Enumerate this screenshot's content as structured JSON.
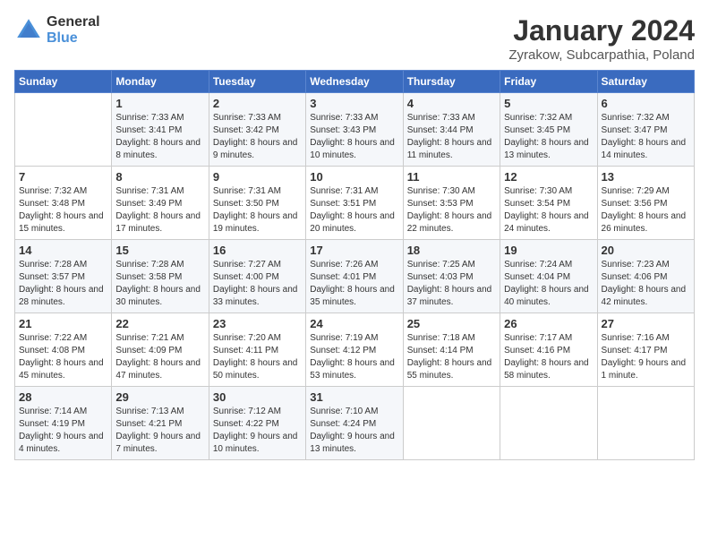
{
  "header": {
    "logo_line1": "General",
    "logo_line2": "Blue",
    "title": "January 2024",
    "subtitle": "Zyrakow, Subcarpathia, Poland"
  },
  "weekdays": [
    "Sunday",
    "Monday",
    "Tuesday",
    "Wednesday",
    "Thursday",
    "Friday",
    "Saturday"
  ],
  "weeks": [
    [
      {
        "day": "",
        "sunrise": "",
        "sunset": "",
        "daylight": ""
      },
      {
        "day": "1",
        "sunrise": "Sunrise: 7:33 AM",
        "sunset": "Sunset: 3:41 PM",
        "daylight": "Daylight: 8 hours and 8 minutes."
      },
      {
        "day": "2",
        "sunrise": "Sunrise: 7:33 AM",
        "sunset": "Sunset: 3:42 PM",
        "daylight": "Daylight: 8 hours and 9 minutes."
      },
      {
        "day": "3",
        "sunrise": "Sunrise: 7:33 AM",
        "sunset": "Sunset: 3:43 PM",
        "daylight": "Daylight: 8 hours and 10 minutes."
      },
      {
        "day": "4",
        "sunrise": "Sunrise: 7:33 AM",
        "sunset": "Sunset: 3:44 PM",
        "daylight": "Daylight: 8 hours and 11 minutes."
      },
      {
        "day": "5",
        "sunrise": "Sunrise: 7:32 AM",
        "sunset": "Sunset: 3:45 PM",
        "daylight": "Daylight: 8 hours and 13 minutes."
      },
      {
        "day": "6",
        "sunrise": "Sunrise: 7:32 AM",
        "sunset": "Sunset: 3:47 PM",
        "daylight": "Daylight: 8 hours and 14 minutes."
      }
    ],
    [
      {
        "day": "7",
        "sunrise": "Sunrise: 7:32 AM",
        "sunset": "Sunset: 3:48 PM",
        "daylight": "Daylight: 8 hours and 15 minutes."
      },
      {
        "day": "8",
        "sunrise": "Sunrise: 7:31 AM",
        "sunset": "Sunset: 3:49 PM",
        "daylight": "Daylight: 8 hours and 17 minutes."
      },
      {
        "day": "9",
        "sunrise": "Sunrise: 7:31 AM",
        "sunset": "Sunset: 3:50 PM",
        "daylight": "Daylight: 8 hours and 19 minutes."
      },
      {
        "day": "10",
        "sunrise": "Sunrise: 7:31 AM",
        "sunset": "Sunset: 3:51 PM",
        "daylight": "Daylight: 8 hours and 20 minutes."
      },
      {
        "day": "11",
        "sunrise": "Sunrise: 7:30 AM",
        "sunset": "Sunset: 3:53 PM",
        "daylight": "Daylight: 8 hours and 22 minutes."
      },
      {
        "day": "12",
        "sunrise": "Sunrise: 7:30 AM",
        "sunset": "Sunset: 3:54 PM",
        "daylight": "Daylight: 8 hours and 24 minutes."
      },
      {
        "day": "13",
        "sunrise": "Sunrise: 7:29 AM",
        "sunset": "Sunset: 3:56 PM",
        "daylight": "Daylight: 8 hours and 26 minutes."
      }
    ],
    [
      {
        "day": "14",
        "sunrise": "Sunrise: 7:28 AM",
        "sunset": "Sunset: 3:57 PM",
        "daylight": "Daylight: 8 hours and 28 minutes."
      },
      {
        "day": "15",
        "sunrise": "Sunrise: 7:28 AM",
        "sunset": "Sunset: 3:58 PM",
        "daylight": "Daylight: 8 hours and 30 minutes."
      },
      {
        "day": "16",
        "sunrise": "Sunrise: 7:27 AM",
        "sunset": "Sunset: 4:00 PM",
        "daylight": "Daylight: 8 hours and 33 minutes."
      },
      {
        "day": "17",
        "sunrise": "Sunrise: 7:26 AM",
        "sunset": "Sunset: 4:01 PM",
        "daylight": "Daylight: 8 hours and 35 minutes."
      },
      {
        "day": "18",
        "sunrise": "Sunrise: 7:25 AM",
        "sunset": "Sunset: 4:03 PM",
        "daylight": "Daylight: 8 hours and 37 minutes."
      },
      {
        "day": "19",
        "sunrise": "Sunrise: 7:24 AM",
        "sunset": "Sunset: 4:04 PM",
        "daylight": "Daylight: 8 hours and 40 minutes."
      },
      {
        "day": "20",
        "sunrise": "Sunrise: 7:23 AM",
        "sunset": "Sunset: 4:06 PM",
        "daylight": "Daylight: 8 hours and 42 minutes."
      }
    ],
    [
      {
        "day": "21",
        "sunrise": "Sunrise: 7:22 AM",
        "sunset": "Sunset: 4:08 PM",
        "daylight": "Daylight: 8 hours and 45 minutes."
      },
      {
        "day": "22",
        "sunrise": "Sunrise: 7:21 AM",
        "sunset": "Sunset: 4:09 PM",
        "daylight": "Daylight: 8 hours and 47 minutes."
      },
      {
        "day": "23",
        "sunrise": "Sunrise: 7:20 AM",
        "sunset": "Sunset: 4:11 PM",
        "daylight": "Daylight: 8 hours and 50 minutes."
      },
      {
        "day": "24",
        "sunrise": "Sunrise: 7:19 AM",
        "sunset": "Sunset: 4:12 PM",
        "daylight": "Daylight: 8 hours and 53 minutes."
      },
      {
        "day": "25",
        "sunrise": "Sunrise: 7:18 AM",
        "sunset": "Sunset: 4:14 PM",
        "daylight": "Daylight: 8 hours and 55 minutes."
      },
      {
        "day": "26",
        "sunrise": "Sunrise: 7:17 AM",
        "sunset": "Sunset: 4:16 PM",
        "daylight": "Daylight: 8 hours and 58 minutes."
      },
      {
        "day": "27",
        "sunrise": "Sunrise: 7:16 AM",
        "sunset": "Sunset: 4:17 PM",
        "daylight": "Daylight: 9 hours and 1 minute."
      }
    ],
    [
      {
        "day": "28",
        "sunrise": "Sunrise: 7:14 AM",
        "sunset": "Sunset: 4:19 PM",
        "daylight": "Daylight: 9 hours and 4 minutes."
      },
      {
        "day": "29",
        "sunrise": "Sunrise: 7:13 AM",
        "sunset": "Sunset: 4:21 PM",
        "daylight": "Daylight: 9 hours and 7 minutes."
      },
      {
        "day": "30",
        "sunrise": "Sunrise: 7:12 AM",
        "sunset": "Sunset: 4:22 PM",
        "daylight": "Daylight: 9 hours and 10 minutes."
      },
      {
        "day": "31",
        "sunrise": "Sunrise: 7:10 AM",
        "sunset": "Sunset: 4:24 PM",
        "daylight": "Daylight: 9 hours and 13 minutes."
      },
      {
        "day": "",
        "sunrise": "",
        "sunset": "",
        "daylight": ""
      },
      {
        "day": "",
        "sunrise": "",
        "sunset": "",
        "daylight": ""
      },
      {
        "day": "",
        "sunrise": "",
        "sunset": "",
        "daylight": ""
      }
    ]
  ]
}
